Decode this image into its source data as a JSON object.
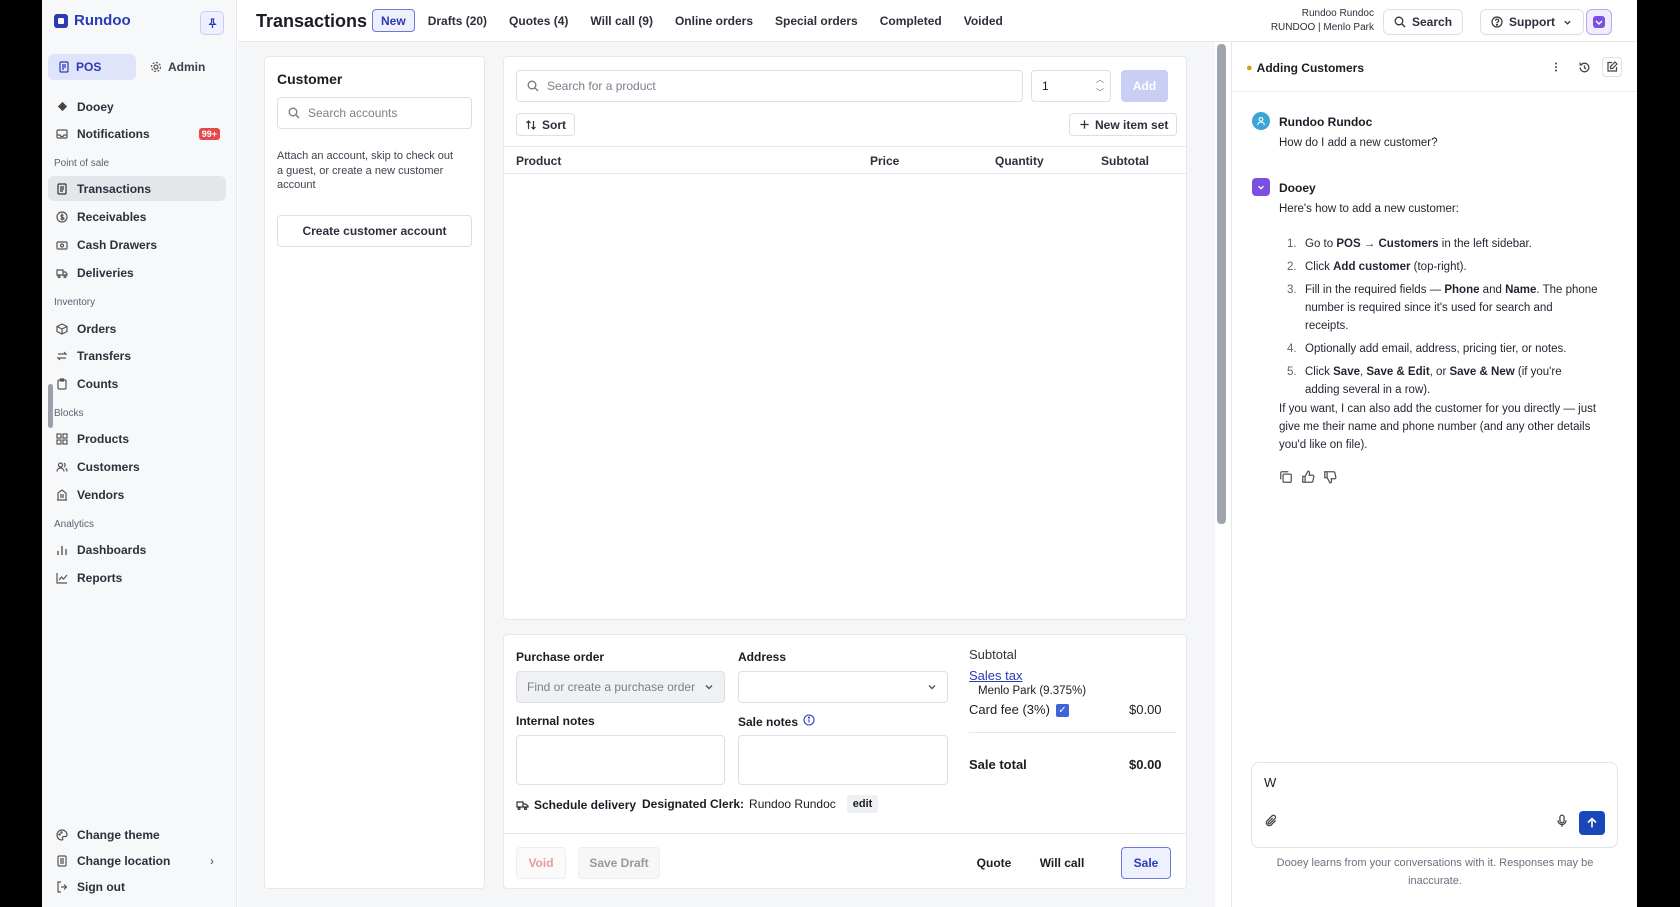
{
  "app": {
    "name": "Rundoo"
  },
  "sidebar": {
    "modes": [
      {
        "label": "POS",
        "icon": "pos-icon",
        "active": true
      },
      {
        "label": "Admin",
        "icon": "gear-icon",
        "active": false
      }
    ],
    "top_items": [
      {
        "label": "Dooey",
        "icon": "dooey-icon"
      },
      {
        "label": "Notifications",
        "icon": "inbox-icon",
        "badge": "99+"
      }
    ],
    "sections": [
      {
        "title": "Point of sale",
        "items": [
          {
            "label": "Transactions",
            "icon": "receipt-icon",
            "active": true
          },
          {
            "label": "Receivables",
            "icon": "dollar-icon"
          },
          {
            "label": "Cash Drawers",
            "icon": "cash-icon"
          },
          {
            "label": "Deliveries",
            "icon": "truck-icon"
          }
        ]
      },
      {
        "title": "Inventory",
        "items": [
          {
            "label": "Orders",
            "icon": "box-icon"
          },
          {
            "label": "Transfers",
            "icon": "transfer-icon"
          },
          {
            "label": "Counts",
            "icon": "clipboard-icon"
          }
        ]
      },
      {
        "title": "Blocks",
        "items": [
          {
            "label": "Products",
            "icon": "grid-icon"
          },
          {
            "label": "Customers",
            "icon": "users-icon"
          },
          {
            "label": "Vendors",
            "icon": "building-icon"
          }
        ]
      },
      {
        "title": "Analytics",
        "items": [
          {
            "label": "Dashboards",
            "icon": "bar-chart-icon"
          },
          {
            "label": "Reports",
            "icon": "line-chart-icon"
          }
        ]
      }
    ],
    "bottom_items": [
      {
        "label": "Change theme",
        "icon": "palette-icon"
      },
      {
        "label": "Change location",
        "icon": "location-icon"
      },
      {
        "label": "Sign out",
        "icon": "sign-out-icon"
      }
    ]
  },
  "topbar": {
    "title": "Transactions",
    "tabs": [
      "New",
      "Drafts (20)",
      "Quotes (4)",
      "Will call (9)",
      "Online orders",
      "Special orders",
      "Completed",
      "Voided"
    ],
    "user_name": "Rundoo Rundoc",
    "user_location": "RUNDOO | Menlo Park",
    "search_label": "Search",
    "support_label": "Support"
  },
  "customer": {
    "title": "Customer",
    "search_placeholder": "Search accounts",
    "hint": "Attach an account, skip to check out a guest, or create a new customer account",
    "create_label": "Create customer account"
  },
  "products": {
    "search_placeholder": "Search for a product",
    "quantity": "1",
    "add_label": "Add",
    "sort_label": "Sort",
    "new_item_set_label": "New item set",
    "columns": [
      "Product",
      "Price",
      "Quantity",
      "Subtotal"
    ]
  },
  "order": {
    "purchase_order_label": "Purchase order",
    "purchase_order_placeholder": "Find or create a purchase order",
    "address_label": "Address",
    "internal_notes_label": "Internal notes",
    "sale_notes_label": "Sale notes",
    "schedule_delivery_label": "Schedule delivery",
    "designated_clerk_label": "Designated Clerk:",
    "designated_clerk_value": "Rundoo Rundoc",
    "edit_label": "edit"
  },
  "summary": {
    "subtotal_label": "Subtotal",
    "sales_tax_label": "Sales tax",
    "sales_tax_detail": "Menlo Park (9.375%)",
    "card_fee_label": "Card fee (3%)",
    "card_fee_checked": true,
    "card_fee_value": "$0.00",
    "sale_total_label": "Sale total",
    "sale_total_value": "$0.00"
  },
  "footer": {
    "void_label": "Void",
    "save_draft_label": "Save Draft",
    "quote_label": "Quote",
    "will_call_label": "Will call",
    "sale_label": "Sale"
  },
  "chat": {
    "title": "Adding Customers",
    "user_name": "Rundoo Rundoc",
    "user_message": "How do I add a new customer?",
    "bot_name": "Dooey",
    "bot_intro": "Here's how to add a new customer:",
    "steps": [
      [
        "Go to ",
        {
          "b": "POS → Customers"
        },
        " in the left sidebar."
      ],
      [
        "Click ",
        {
          "b": "Add customer"
        },
        " (top-right)."
      ],
      [
        "Fill in the required fields — ",
        {
          "b": "Phone"
        },
        " and ",
        {
          "b": "Name"
        },
        ". The phone number is required since it's used for search and receipts."
      ],
      [
        "Optionally add email, address, pricing tier, or notes."
      ],
      [
        "Click ",
        {
          "b": "Save"
        },
        ", ",
        {
          "b": "Save & Edit"
        },
        ", or ",
        {
          "b": "Save & New"
        },
        " (if you're adding several in a row)."
      ]
    ],
    "bot_outro": "If you want, I can also add the customer for you directly — just give me their name and phone number (and any other details you'd like on file).",
    "composer_value": "W",
    "disclaimer": "Dooey learns from your conversations with it. Responses may be inaccurate."
  },
  "colors": {
    "brand": "#2a3bb5",
    "accent_purple": "#7b4fe0",
    "badge_red": "#e5484d"
  }
}
